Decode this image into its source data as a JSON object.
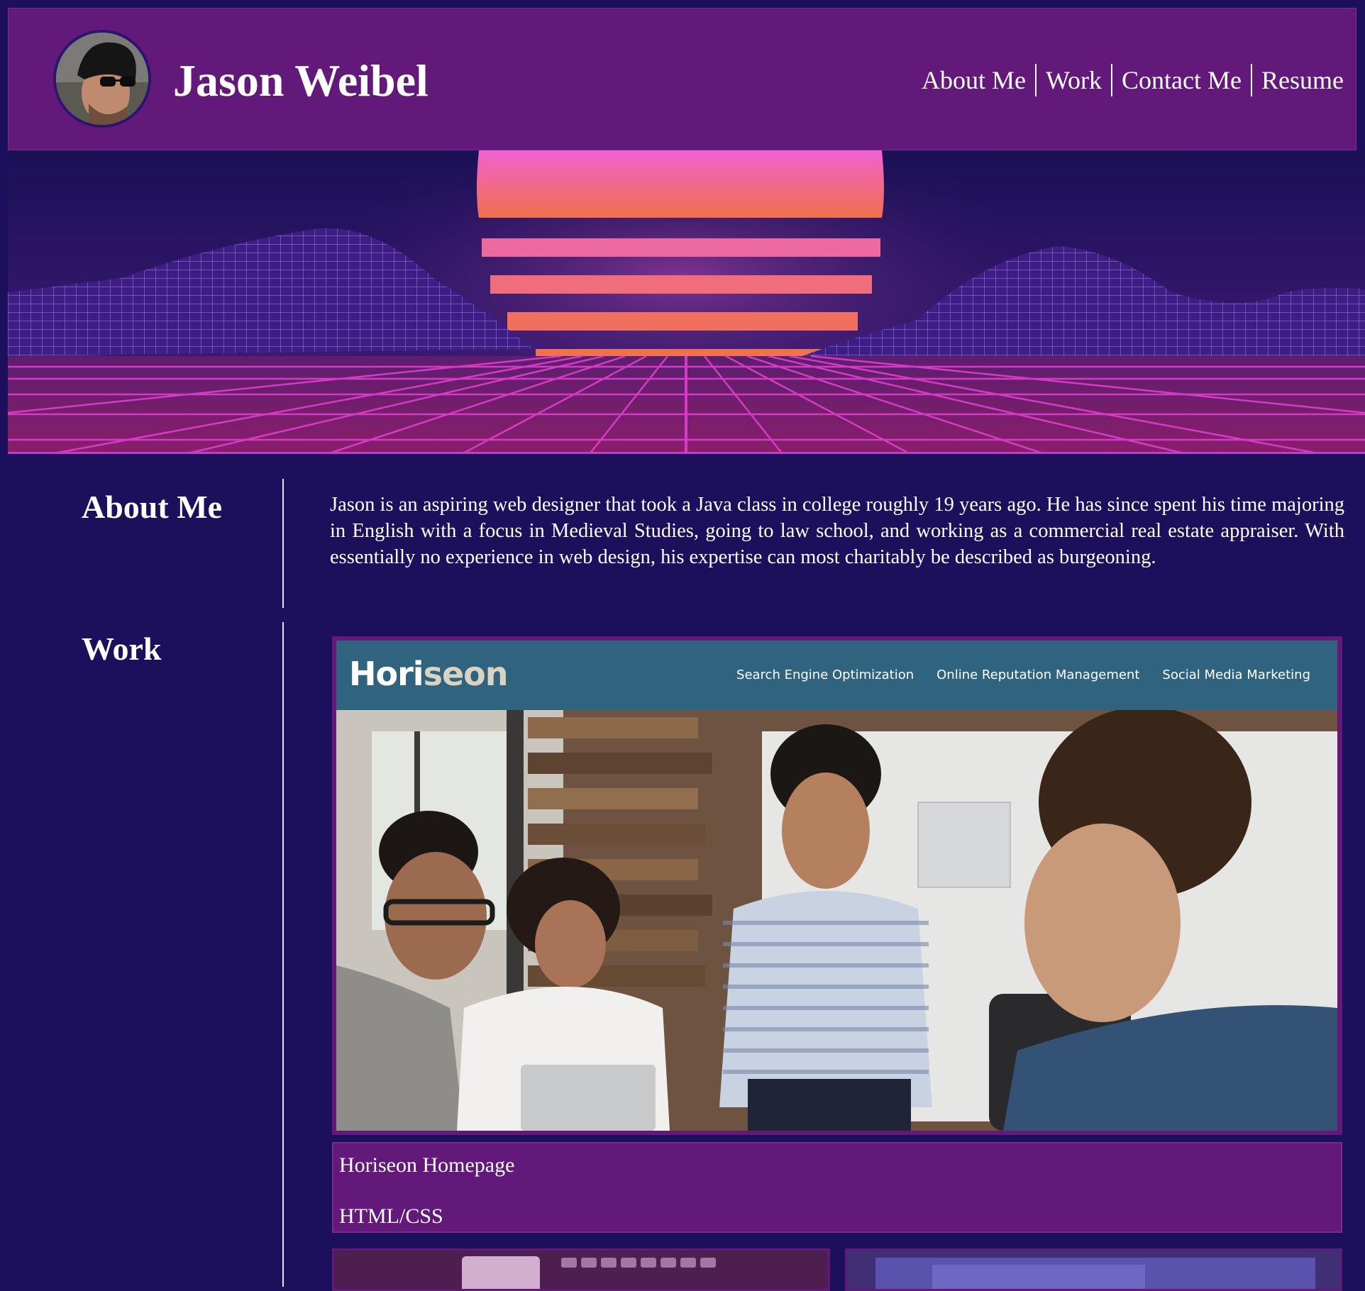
{
  "header": {
    "name": "Jason Weibel",
    "nav": [
      "About Me",
      "Work",
      "Contact Me",
      "Resume"
    ]
  },
  "about": {
    "heading": "About Me",
    "text": "Jason is an aspiring web designer that took a Java class in college roughly 19 years ago. He has since spent his time majoring in English with a focus in Medieval Studies, going to law school, and working as a commercial real estate appraiser. With essentially no experience in web design, his expertise can most charitably be described as burgeoning."
  },
  "work": {
    "heading": "Work",
    "featured": {
      "logo_main": "Hori",
      "logo_accent": "seon",
      "links": [
        "Search Engine Optimization",
        "Online Reputation Management",
        "Social Media Marketing"
      ],
      "title": "Horiseon Homepage",
      "tech": "HTML/CSS"
    }
  },
  "colors": {
    "background": "#1c0f5c",
    "header": "#631979",
    "horiseon_nav": "#30637e",
    "sun_top": "#f062cf",
    "sun_bottom": "#f17048"
  }
}
